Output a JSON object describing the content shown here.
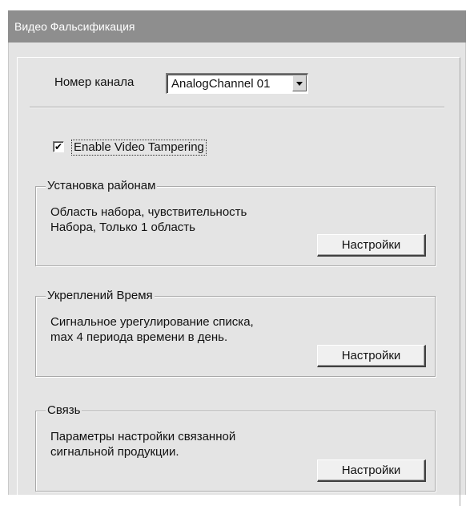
{
  "window": {
    "title": "Видео Фальсификация"
  },
  "channel": {
    "label": "Номер канала",
    "selected": "AnalogChannel 01"
  },
  "enable_checkbox": {
    "label": "Enable Video Tampering",
    "checked": true,
    "mark": "✔"
  },
  "groups": [
    {
      "title": "Установка районам",
      "desc_line1": "Область набора, чувствительность",
      "desc_line2": "Набора, Только 1 область",
      "button": "Настройки"
    },
    {
      "title": "Укреплений Время",
      "desc_line1": "Сигнальное урегулирование списка,",
      "desc_line2": "max 4 периода времени в день.",
      "button": "Настройки"
    },
    {
      "title": "Связь",
      "desc_line1": "Параметры настройки связанной",
      "desc_line2": "сигнальной продукции.",
      "button": "Настройки"
    }
  ],
  "colors": {
    "title_bar": "#8e8e8e",
    "panel": "#e4e4e4"
  }
}
